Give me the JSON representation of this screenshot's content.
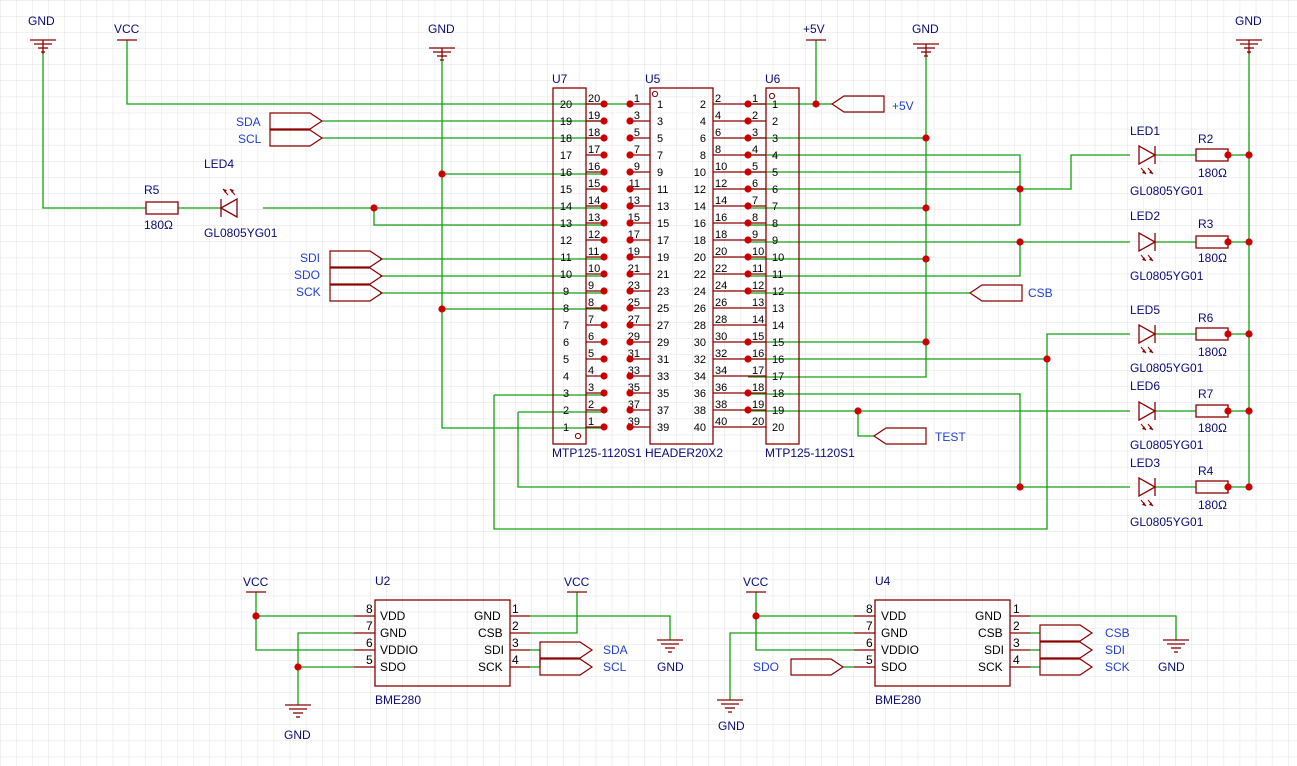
{
  "colors": {
    "wire": "#11a011",
    "part": "#8b0000",
    "junction": "#cc0000",
    "text_ref": "#0a0a7a",
    "text_net": "#1f3fd0",
    "grid": "#dcdcdc"
  },
  "u7": {
    "ref": "U7",
    "value": "MTP125-1120S1",
    "outer": [
      "20",
      "19",
      "18",
      "17",
      "16",
      "15",
      "14",
      "13",
      "12",
      "11",
      "10",
      "9",
      "8",
      "7",
      "6",
      "5",
      "4",
      "3",
      "2",
      "1"
    ],
    "inner": [
      "20",
      "19",
      "18",
      "17",
      "16",
      "15",
      "14",
      "13",
      "12",
      "11",
      "10",
      "9",
      "8",
      "7",
      "6",
      "5",
      "4",
      "3",
      "2",
      "1"
    ]
  },
  "u5": {
    "ref": "U5",
    "value": "HEADER20X2",
    "odd": [
      "1",
      "3",
      "5",
      "7",
      "9",
      "11",
      "13",
      "15",
      "17",
      "19",
      "21",
      "23",
      "25",
      "27",
      "29",
      "31",
      "33",
      "35",
      "37",
      "39"
    ],
    "even": [
      "2",
      "4",
      "6",
      "8",
      "10",
      "12",
      "14",
      "16",
      "18",
      "20",
      "22",
      "24",
      "26",
      "28",
      "30",
      "32",
      "34",
      "36",
      "38",
      "40"
    ]
  },
  "u6": {
    "ref": "U6",
    "value": "MTP125-1120S1",
    "pins": [
      "1",
      "2",
      "3",
      "4",
      "5",
      "6",
      "7",
      "8",
      "9",
      "10",
      "11",
      "12",
      "13",
      "14",
      "15",
      "16",
      "17",
      "18",
      "19",
      "20"
    ]
  },
  "power": {
    "gnd": "GND",
    "vcc": "VCC",
    "p5v": "+5V"
  },
  "nets": {
    "sda": "SDA",
    "scl": "SCL",
    "sdi": "SDI",
    "sdo": "SDO",
    "sck": "SCK",
    "csb": "CSB",
    "test": "TEST",
    "p5v": "+5V"
  },
  "leds": [
    {
      "ref": "LED1",
      "value": "GL0805YG01"
    },
    {
      "ref": "LED2",
      "value": "GL0805YG01"
    },
    {
      "ref": "LED5",
      "value": "GL0805YG01"
    },
    {
      "ref": "LED6",
      "value": "GL0805YG01"
    },
    {
      "ref": "LED3",
      "value": "GL0805YG01"
    },
    {
      "ref": "LED4",
      "value": "GL0805YG01"
    }
  ],
  "resistors": [
    {
      "ref": "R2",
      "value": "180Ω"
    },
    {
      "ref": "R3",
      "value": "180Ω"
    },
    {
      "ref": "R6",
      "value": "180Ω"
    },
    {
      "ref": "R7",
      "value": "180Ω"
    },
    {
      "ref": "R4",
      "value": "180Ω"
    },
    {
      "ref": "R5",
      "value": "180Ω"
    }
  ],
  "u2": {
    "ref": "U2",
    "value": "BME280",
    "left": [
      {
        "num": "8",
        "name": "VDD"
      },
      {
        "num": "7",
        "name": "GND"
      },
      {
        "num": "6",
        "name": "VDDIO"
      },
      {
        "num": "5",
        "name": "SDO"
      }
    ],
    "right": [
      {
        "num": "1",
        "name": "GND"
      },
      {
        "num": "2",
        "name": "CSB"
      },
      {
        "num": "3",
        "name": "SDI"
      },
      {
        "num": "4",
        "name": "SCK"
      }
    ]
  },
  "u4": {
    "ref": "U4",
    "value": "BME280",
    "left": [
      {
        "num": "8",
        "name": "VDD"
      },
      {
        "num": "7",
        "name": "GND"
      },
      {
        "num": "6",
        "name": "VDDIO"
      },
      {
        "num": "5",
        "name": "SDO"
      }
    ],
    "right": [
      {
        "num": "1",
        "name": "GND"
      },
      {
        "num": "2",
        "name": "CSB"
      },
      {
        "num": "3",
        "name": "SDI"
      },
      {
        "num": "4",
        "name": "SCK"
      }
    ]
  }
}
